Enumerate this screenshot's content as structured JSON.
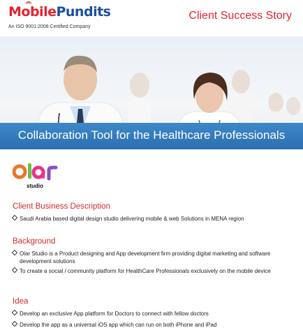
{
  "header": {
    "logo_part1": "Mobile",
    "logo_part2": "Pundits",
    "certification": "An ISO 9001:2008 Certified Company",
    "tagline": "Client Success Story"
  },
  "banner": {
    "title": "Collaboration Tool for the Healthcare Professionals"
  },
  "client_logo": {
    "text": "olar",
    "subtext": "studio"
  },
  "sections": {
    "business": {
      "title": "Client Business Description",
      "bullets": [
        "Saudi Arabia based digital design studio delivering mobile & web Solutions in MENA region"
      ]
    },
    "background": {
      "title": "Background",
      "bullets": [
        "Olar Studio is a Product designing and App development firm providing digital marketing and software development solutions",
        "To create a social / community platform for HealthCare Professionals exclusively on the mobile device"
      ]
    },
    "idea": {
      "title": "Idea",
      "bullets": [
        "Develop an exclusive App platform for Doctors to connect with fellow doctors",
        "Develop the app as a universal iOS app which can run on both iPhone and iPad"
      ]
    }
  },
  "colors": {
    "accent_red": "#e52330",
    "brand_blue": "#1d4f9e",
    "banner_blue": "#2b6fb0"
  }
}
